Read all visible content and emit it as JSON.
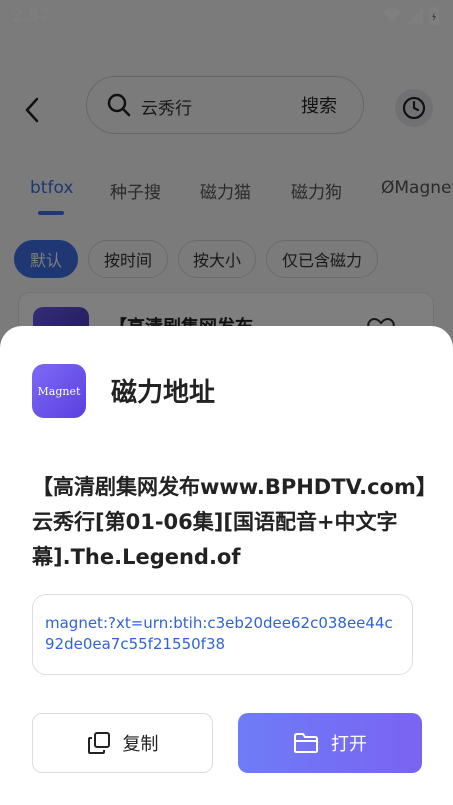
{
  "status_bar": {
    "time": "2:57"
  },
  "search": {
    "query": "云秀行",
    "button_label": "搜索"
  },
  "tabs": [
    "btfox",
    "种子搜",
    "磁力猫",
    "磁力狗",
    "ØMagnet"
  ],
  "filters": [
    "默认",
    "按时间",
    "按大小",
    "仅已含磁力"
  ],
  "result_card": {
    "title": "【高清剧集网发布"
  },
  "sheet": {
    "logo_text": "Magnet",
    "title": "磁力地址",
    "name": "【高清剧集网发布www.BPHDTV.com】云秀行[第01-06集][国语配音+中文字幕].The.Legend.of",
    "magnet": "magnet:?xt=urn:btih:c3eb20dee62c038ee44c92de0ea7c55f21550f38",
    "copy_label": "复制",
    "open_label": "打开"
  },
  "colors": {
    "accent": "#3e6ee4",
    "button_gradient_start": "#6e7cf7",
    "button_gradient_end": "#7a63f2"
  }
}
